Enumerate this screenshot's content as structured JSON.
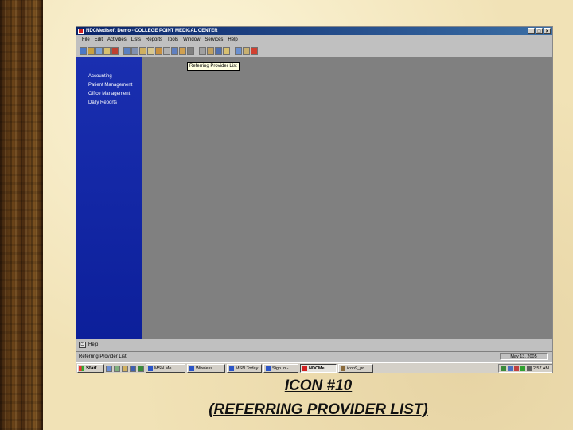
{
  "window": {
    "title": "NDCMedisoft Demo - COLLEGE POINT MEDICAL CENTER",
    "buttons": {
      "minimize": "_",
      "maximize": "□",
      "close": "×"
    }
  },
  "menu": [
    "File",
    "Edit",
    "Activities",
    "Lists",
    "Reports",
    "Tools",
    "Window",
    "Services",
    "Help"
  ],
  "tooltip": "Referring Provider List",
  "sidebar": {
    "items": [
      "Accounting",
      "Patient Management",
      "Office Management",
      "Daily Reports"
    ]
  },
  "helpbar": {
    "label": "Help"
  },
  "statusbar": {
    "text": "Referring Provider List",
    "date": "May 13, 2005"
  },
  "taskbar": {
    "start": "Start",
    "tasks": [
      "MSN Me...",
      "Wireless ...",
      "MSN Today",
      "Sign In - ...",
      "NDCMe...",
      "icon9_pr..."
    ],
    "active_task": "NDCMe...",
    "clock": "2:57 AM"
  },
  "caption": {
    "line1": "ICON #10",
    "line2": "(REFERRING PROVIDER LIST)"
  },
  "colors": {
    "sidebar": "#0c1f9a",
    "workspace": "#808080",
    "titlebar": "#0a246a"
  }
}
